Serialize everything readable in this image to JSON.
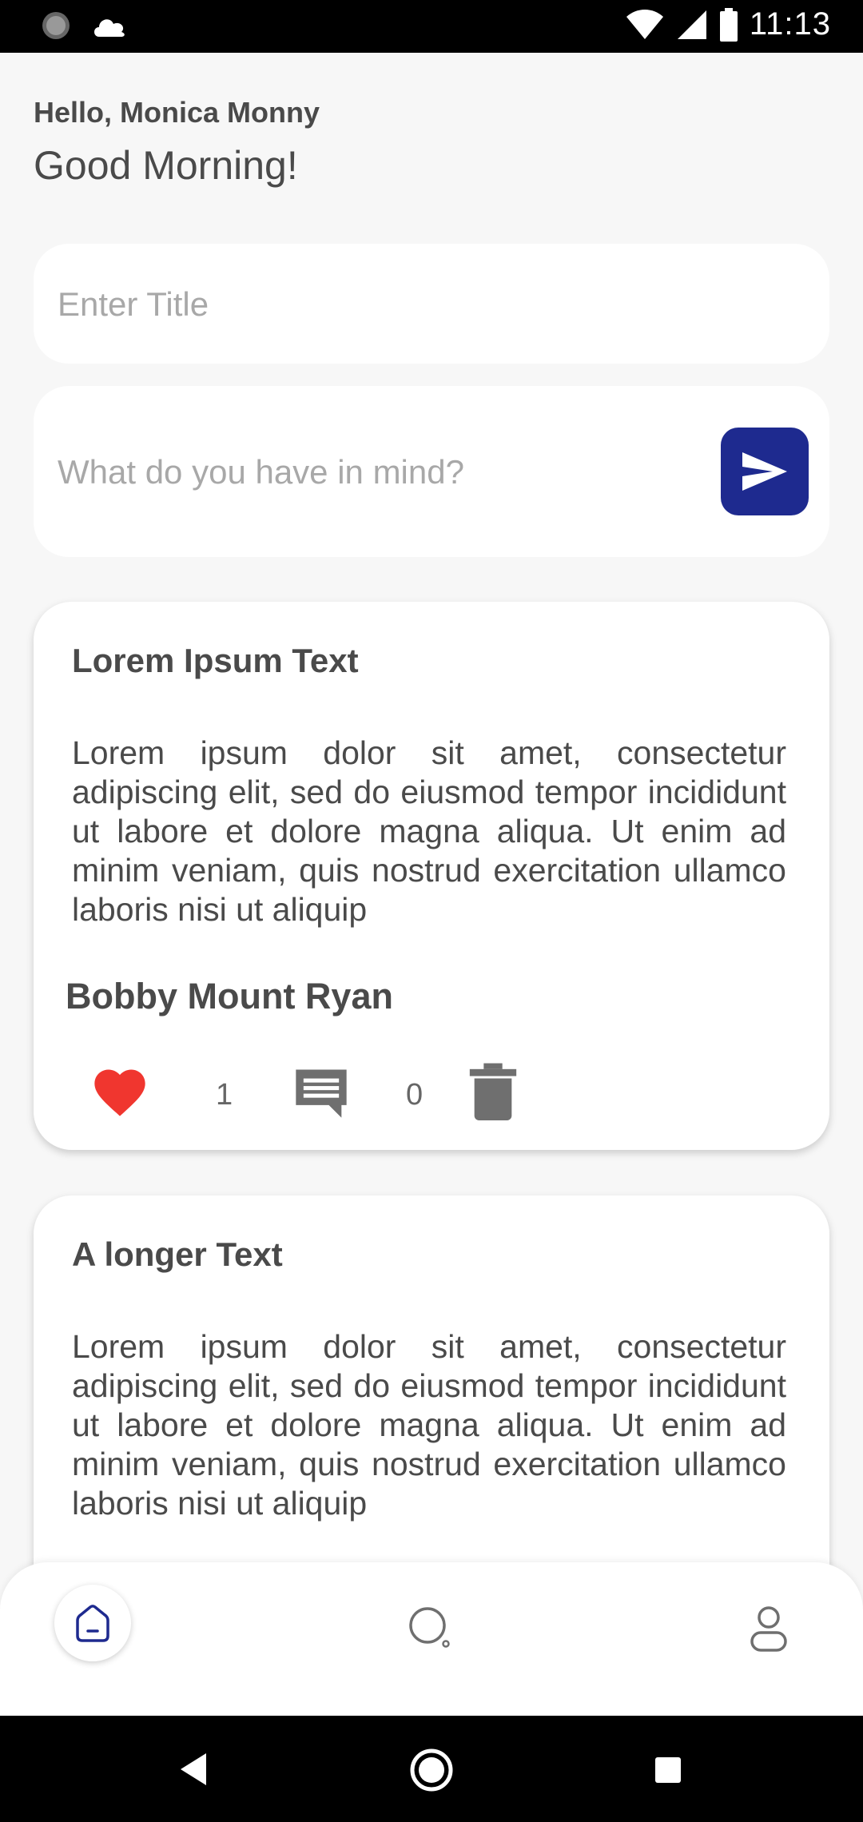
{
  "status_bar": {
    "time": "11:13",
    "icons": [
      "spinner-icon",
      "cloud-icon",
      "wifi-icon",
      "signal-icon",
      "battery-icon"
    ]
  },
  "greeting": {
    "hello": "Hello, Monica Monny",
    "subtitle": "Good Morning!"
  },
  "composer": {
    "title_placeholder": "Enter Title",
    "title_value": "",
    "body_placeholder": "What do you have in mind?",
    "body_value": "",
    "send_icon": "send-icon"
  },
  "posts": [
    {
      "title": "Lorem Ipsum Text",
      "body": "Lorem ipsum dolor sit amet, consectetur adipiscing elit, sed do eiusmod tempor incididunt ut labore et dolore magna aliqua. Ut enim ad minim veniam, quis nostrud exercitation ullamco laboris nisi ut aliquip",
      "author": "Bobby Mount Ryan",
      "likes": "1",
      "comments": "0"
    },
    {
      "title": "A longer Text",
      "body": "Lorem ipsum dolor sit amet, consectetur adipiscing elit, sed do eiusmod tempor incididunt ut labore et dolore magna aliqua. Ut enim ad minim veniam, quis nostrud exercitation ullamco laboris nisi ut aliquip"
    }
  ],
  "bottom_nav": {
    "items": [
      "home-icon",
      "search-icon",
      "profile-icon"
    ],
    "active": "home-icon"
  },
  "colors": {
    "accent": "#1e2a8f",
    "like": "#f0362f",
    "background": "#f7f7f7",
    "card": "#ffffff",
    "text": "#4a4a4a",
    "placeholder": "#a8a8a8",
    "icon_gray": "#6f6f6f"
  }
}
